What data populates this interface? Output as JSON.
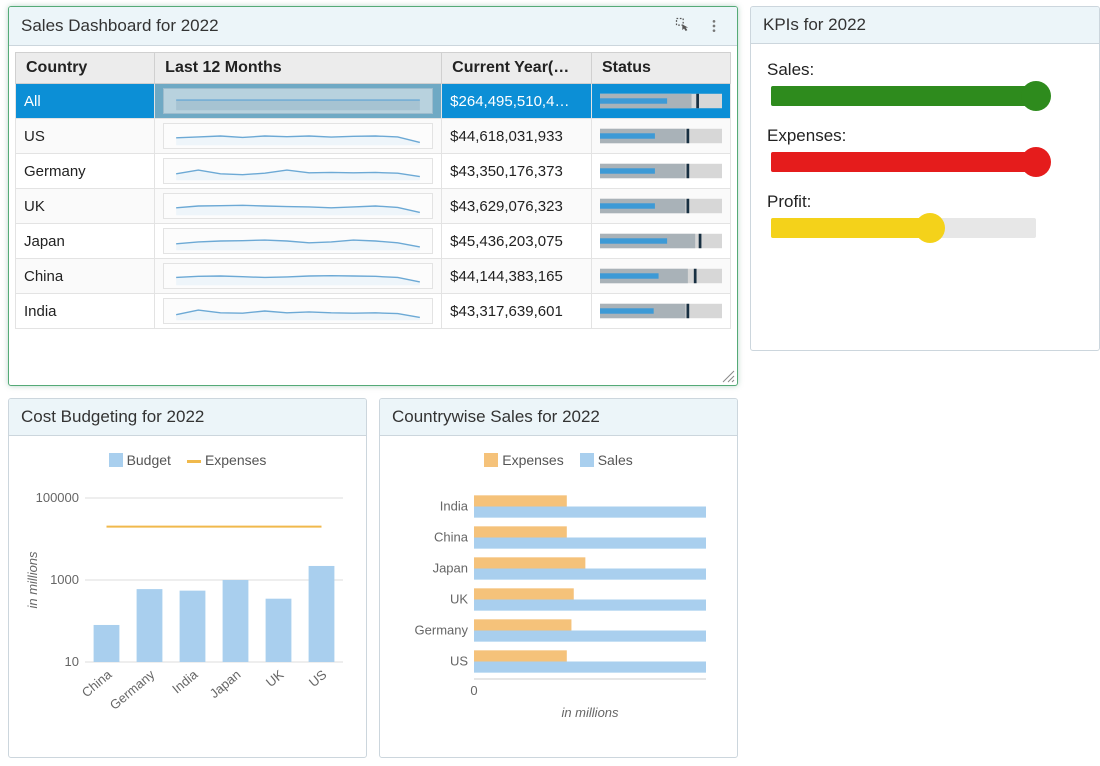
{
  "panels": {
    "sales": {
      "title": "Sales Dashboard for 2022"
    },
    "kpi": {
      "title": "KPIs for 2022"
    },
    "cost": {
      "title": "Cost Budgeting for 2022"
    },
    "country": {
      "title": "Countrywise Sales for 2022"
    }
  },
  "sales_table": {
    "columns": [
      "Country",
      "Last 12 Months",
      "Current Year(…",
      "Status"
    ],
    "rows": [
      {
        "country": "All",
        "current": "$264,495,510,4…",
        "selected": true,
        "spark": [
          0.55,
          0.55,
          0.55,
          0.55,
          0.55,
          0.55,
          0.55,
          0.55,
          0.55,
          0.55,
          0.55,
          0.55
        ],
        "status": {
          "range": 1.0,
          "good": 0.75,
          "value": 0.55,
          "marker": 0.8
        }
      },
      {
        "country": "US",
        "current": "$44,618,031,933",
        "spark": [
          0.4,
          0.45,
          0.5,
          0.42,
          0.5,
          0.46,
          0.5,
          0.44,
          0.48,
          0.5,
          0.45,
          0.15
        ],
        "status": {
          "range": 1.0,
          "good": 0.7,
          "value": 0.45,
          "marker": 0.72
        }
      },
      {
        "country": "Germany",
        "current": "$43,350,176,373",
        "spark": [
          0.35,
          0.55,
          0.35,
          0.3,
          0.38,
          0.55,
          0.4,
          0.42,
          0.4,
          0.42,
          0.38,
          0.2
        ],
        "status": {
          "range": 1.0,
          "good": 0.7,
          "value": 0.45,
          "marker": 0.72
        }
      },
      {
        "country": "UK",
        "current": "$43,629,076,323",
        "spark": [
          0.4,
          0.5,
          0.52,
          0.54,
          0.5,
          0.47,
          0.45,
          0.4,
          0.45,
          0.5,
          0.42,
          0.15
        ],
        "status": {
          "range": 1.0,
          "good": 0.7,
          "value": 0.45,
          "marker": 0.72
        }
      },
      {
        "country": "Japan",
        "current": "$45,436,203,075",
        "spark": [
          0.35,
          0.45,
          0.5,
          0.52,
          0.55,
          0.5,
          0.4,
          0.45,
          0.55,
          0.5,
          0.4,
          0.18
        ],
        "status": {
          "range": 1.0,
          "good": 0.78,
          "value": 0.55,
          "marker": 0.82
        }
      },
      {
        "country": "China",
        "current": "$44,144,383,165",
        "spark": [
          0.42,
          0.48,
          0.5,
          0.46,
          0.42,
          0.45,
          0.5,
          0.52,
          0.5,
          0.48,
          0.42,
          0.18
        ],
        "status": {
          "range": 1.0,
          "good": 0.72,
          "value": 0.48,
          "marker": 0.78
        }
      },
      {
        "country": "India",
        "current": "$43,317,639,601",
        "spark": [
          0.3,
          0.55,
          0.4,
          0.38,
          0.5,
          0.4,
          0.45,
          0.4,
          0.38,
          0.4,
          0.36,
          0.15
        ],
        "status": {
          "range": 1.0,
          "good": 0.7,
          "value": 0.44,
          "marker": 0.72
        }
      }
    ]
  },
  "kpis": [
    {
      "label": "Sales:",
      "color": "#2e8b1d",
      "fill": 1.0,
      "knob": 1.0
    },
    {
      "label": "Expenses:",
      "color": "#e51c1c",
      "fill": 1.0,
      "knob": 1.0
    },
    {
      "label": "Profit:",
      "color": "#f4d21a",
      "fill": 0.6,
      "knob": 0.6
    }
  ],
  "chart_data": [
    {
      "id": "cost_budgeting",
      "type": "bar",
      "title": "Cost Budgeting for 2022",
      "ylabel": "in millions",
      "yscale": "log",
      "yticks": [
        10,
        1000,
        100000
      ],
      "categories": [
        "China",
        "Germany",
        "India",
        "Japan",
        "UK",
        "US"
      ],
      "series": [
        {
          "name": "Budget",
          "type": "bar",
          "color": "#a9cfee",
          "values": [
            80,
            600,
            550,
            1000,
            350,
            2200
          ]
        },
        {
          "name": "Expenses",
          "type": "line",
          "color": "#f0b94c",
          "values": [
            20000,
            20000,
            20000,
            20000,
            20000,
            20000
          ]
        }
      ]
    },
    {
      "id": "countrywise_sales",
      "type": "bar-horizontal",
      "title": "Countrywise Sales for 2022",
      "xlabel": "in millions",
      "xticks": [
        0
      ],
      "categories": [
        "India",
        "China",
        "Japan",
        "UK",
        "Germany",
        "US"
      ],
      "series": [
        {
          "name": "Expenses",
          "color": "#f5c27a",
          "values": [
            40,
            40,
            48,
            43,
            42,
            40
          ]
        },
        {
          "name": "Sales",
          "color": "#a9cfee",
          "values": [
            100,
            100,
            100,
            100,
            100,
            100
          ]
        }
      ]
    }
  ],
  "colors": {
    "sparkline": "#6ca9d5",
    "bullet_track": "#d7d7d7",
    "bullet_range": "#a9b2b8",
    "bullet_bar": "#3d9ad6",
    "bullet_marker": "#183042"
  }
}
